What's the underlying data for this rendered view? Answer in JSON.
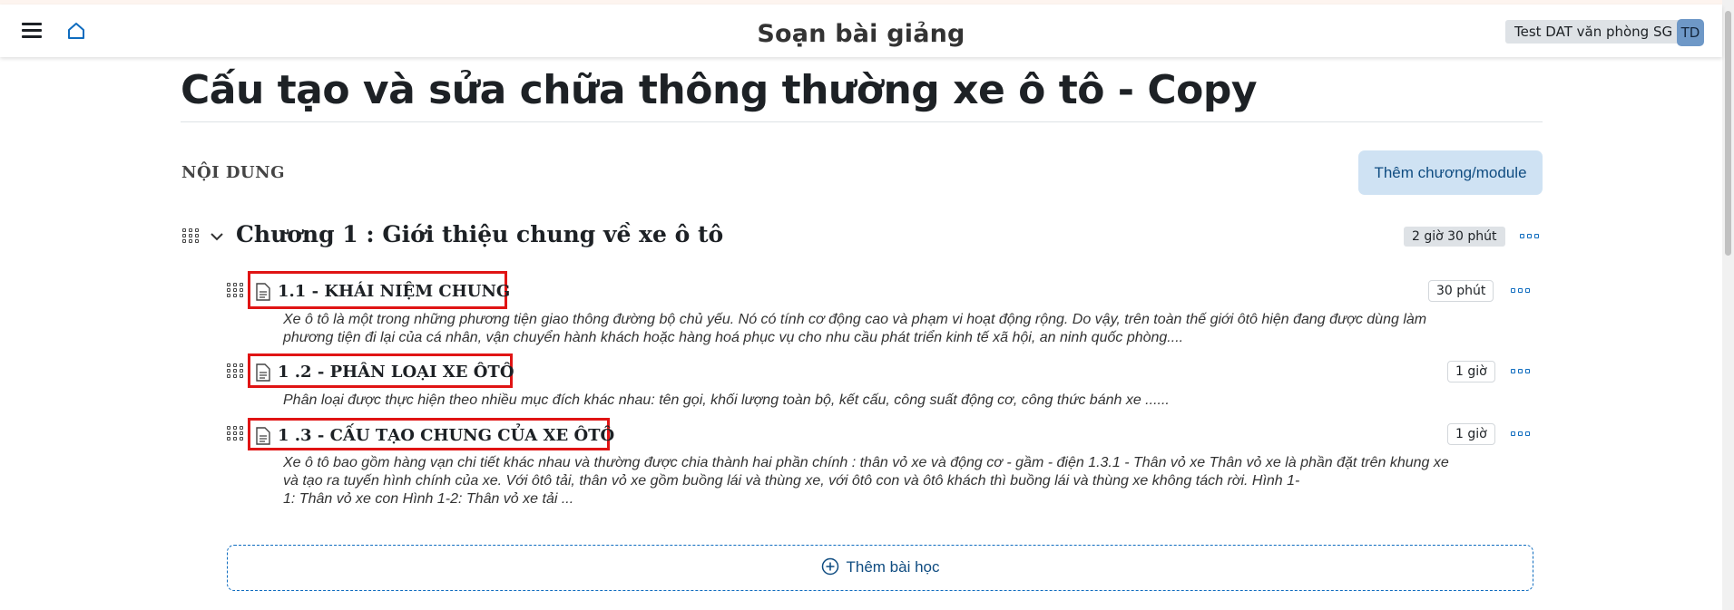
{
  "header": {
    "title": "Soạn bài giảng",
    "user_name": "Test DAT văn phòng SG",
    "user_initials": "TD"
  },
  "course": {
    "title": "Cấu tạo và sửa chữa thông thường xe ô tô - Copy",
    "section_label": "NỘI DUNG",
    "add_module_label": "Thêm chương/module"
  },
  "chapter": {
    "title": "Chương 1 : Giới thiệu chung về xe ô tô",
    "duration": "2 giờ 30 phút",
    "lessons": [
      {
        "title": "1.1 - KHÁI NIỆM CHUNG",
        "duration": "30 phút",
        "description": [
          "Xe ô tô là một trong những phương tiện giao thông đường bộ chủ yếu. Nó có tính cơ động cao và phạm vi hoạt động rộng. Do vậy, trên toàn thế giới ôtô hiện đang được dùng làm",
          "phương tiện đi lại của cá nhân, vận chuyển hành khách hoặc hàng hoá phục vụ cho nhu cầu phát triển kinh tế xã hội, an ninh quốc phòng...."
        ]
      },
      {
        "title": "1 .2 - PHÂN LOẠI XE ÔTÔ",
        "duration": "1 giờ",
        "description": [
          "Phân loại được thực hiện theo nhiều mục đích khác nhau: tên gọi, khối lượng toàn bộ, kết cấu, công suất động cơ, công thức bánh xe ......"
        ]
      },
      {
        "title": "1 .3 - CẤU TẠO CHUNG CỦA XE ÔTÔ",
        "duration": "1 giờ",
        "description": [
          "Xe ô tô bao gồm hàng vạn chi tiết khác nhau và thường được chia thành hai phần chính : thân vỏ xe và động cơ - gầm - điện 1.3.1  - Thân vỏ xe Thân vỏ xe là phần đặt trên khung xe",
          "và tạo ra tuyến hình chính của xe. Với ôtô tải, thân vỏ xe gồm buồng lái và thùng xe, với ôtô con và ôtô khách thì buồng lái và thùng xe không tách rời.                        Hình 1-",
          "1: Thân vỏ xe con                                    Hình 1-2: Thân vỏ xe tải                            ..."
        ]
      }
    ]
  },
  "add_lesson_label": "Thêm bài học",
  "colors": {
    "accent": "#0f6cbf",
    "highlight_border": "#e01414",
    "module_button_bg": "#cfe2f3"
  },
  "icons": [
    "menu-icon",
    "home-icon",
    "drag-handle-icon",
    "chevron-down-icon",
    "document-icon",
    "more-options-icon",
    "plus-circle-icon"
  ]
}
